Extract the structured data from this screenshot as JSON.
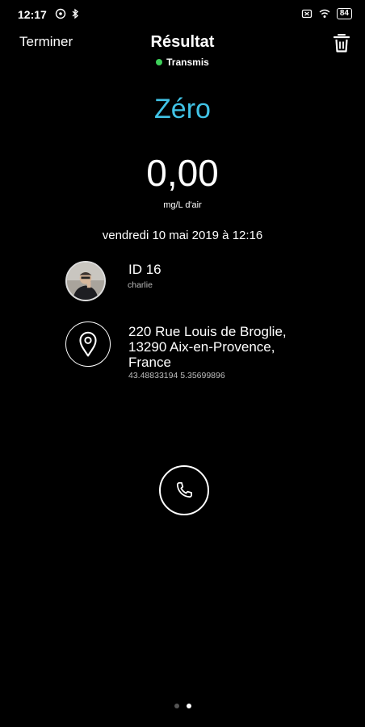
{
  "status_bar": {
    "time": "12:17",
    "battery": "84"
  },
  "header": {
    "done_label": "Terminer",
    "title": "Résultat",
    "subtitle": "Transmis",
    "status_color": "#3ed05a"
  },
  "result": {
    "label": "Zéro",
    "label_color": "#41c3e6",
    "value": "0,00",
    "unit": "mg/L d'air",
    "date": "vendredi 10 mai 2019 à 12:16"
  },
  "user": {
    "id": "ID 16",
    "name": "charlie"
  },
  "location": {
    "address_line1": "220 Rue Louis de Broglie,",
    "address_line2": "13290 Aix-en-Provence,",
    "address_line3": "France",
    "coordinates": "43.48833194 5.35699896"
  },
  "pager": {
    "page": 2,
    "total": 2
  }
}
